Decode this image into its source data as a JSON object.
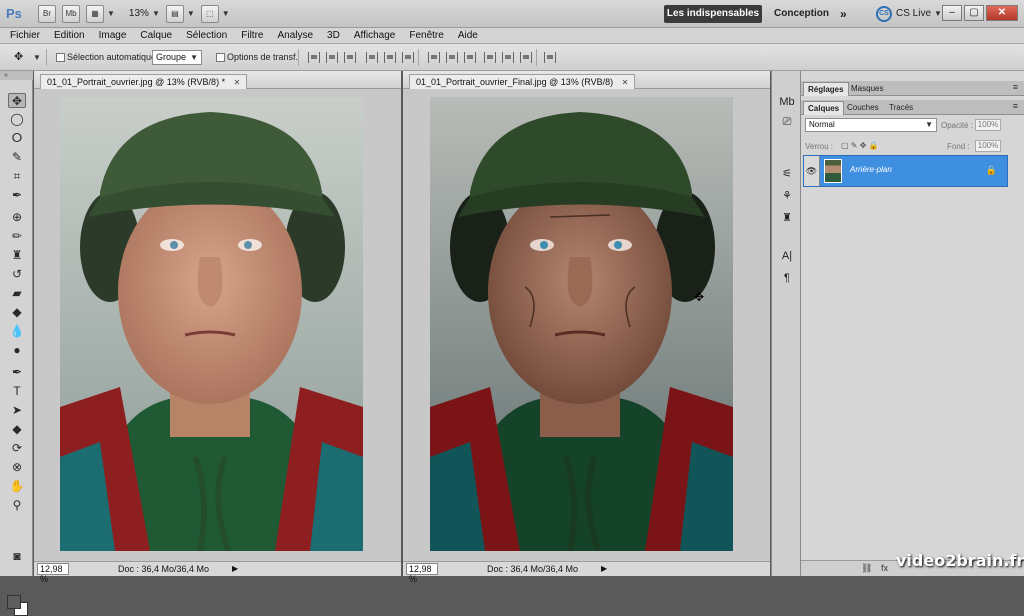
{
  "app": {
    "logo": "Ps",
    "bridge_btn": "Br",
    "minibridge_btn": "Mb",
    "zoom": "13%",
    "workspace_active": "Les indispensables",
    "workspace_other": "Conception",
    "more": "»",
    "cslive_badge": "CS",
    "cslive": "CS Live",
    "win_min": "–",
    "win_max": "▢",
    "win_close": "✕"
  },
  "menu": [
    "Fichier",
    "Edition",
    "Image",
    "Calque",
    "Sélection",
    "Filtre",
    "Analyse",
    "3D",
    "Affichage",
    "Fenêtre",
    "Aide"
  ],
  "options": {
    "tool_icon": "✥",
    "auto_select": "Sélection automatique :",
    "auto_select_value": "Groupe",
    "transform_options": "Options de transf."
  },
  "documents": [
    {
      "tab": "01_01_Portrait_ouvrier.jpg @ 13% (RVB/8) *",
      "close": "✕",
      "zoom": "12,98 %",
      "doc_info": "Doc : 36,4 Mo/36,4 Mo",
      "arrow": "▶"
    },
    {
      "tab": "01_01_Portrait_ouvrier_Final.jpg @ 13% (RVB/8)",
      "close": "✕",
      "zoom": "12,98 %",
      "doc_info": "Doc : 36,4 Mo/36,4 Mo",
      "arrow": "▶"
    }
  ],
  "panels": {
    "top_tabs": [
      "Réglages",
      "Masques"
    ],
    "layer_tabs": [
      "Calques",
      "Couches",
      "Tracés"
    ],
    "blend_mode": "Normal",
    "opacity_label": "Opacité :",
    "opacity_value": "100%",
    "lock_label": "Verrou :",
    "fill_label": "Fond :",
    "fill_value": "100%",
    "layer_name": "Arrière-plan",
    "panel_menu": "≡"
  },
  "watermark": "video2brain.fr",
  "colors": {
    "accent": "#3f8fe0",
    "workspace_active_bg": "#3b3b3b",
    "foreground_swatch": "#5e5e5e",
    "background_swatch": "#ffffff"
  }
}
